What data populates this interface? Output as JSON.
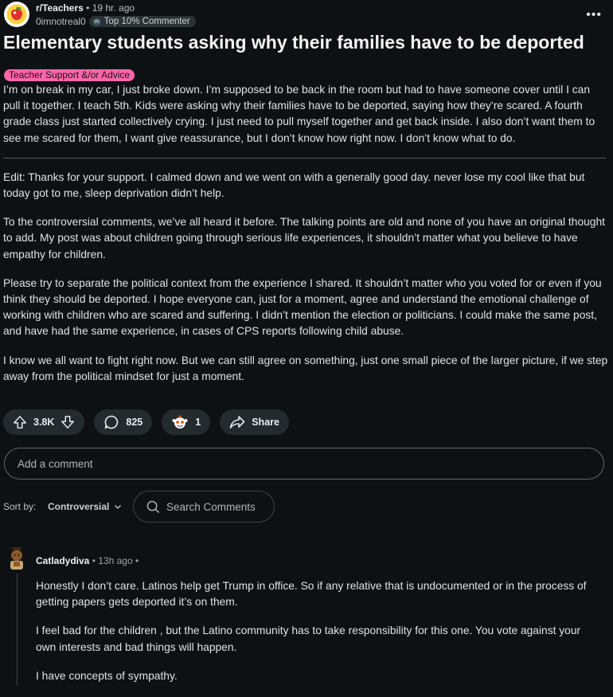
{
  "post": {
    "subreddit": "r/Teachers",
    "time_ago": "19 hr. ago",
    "author": "0imnotreal0",
    "author_badge": "Top 10% Commenter",
    "more_label": "•••",
    "title": "Elementary students asking why their families have to be deported",
    "flair": "Teacher Support &/or Advice",
    "flair_color": "#ff66ac",
    "body_paragraphs": [
      "I’m on break in my car, I just broke down. I’m supposed to be back in the room but had to have someone cover until I can pull it together. I teach 5th. Kids were asking why their families have to be deported, saying how they’re scared. A fourth grade class just started collectively crying. I just need to pull myself together and get back inside. I also don’t want them to see me scared for them, I want give reassurance, but I don’t know how right now. I don’t know what to do.",
      "Edit: Thanks for your support. I calmed down and we went on with a generally good day. never lose my cool like that but today got to me, sleep deprivation didn’t help.",
      "To the controversial comments, we’ve all heard it before. The talking points are old and none of you have an original thought to add. My post was about children going through serious life experiences, it shouldn’t matter what you believe to have empathy for children.",
      "Please try to separate the political context from the experience I shared. It shouldn’t matter who you voted for or even if you think they should be deported. I hope everyone can, just for a moment, agree and understand the emotional challenge of working with children who are scared and suffering. I didn’t mention the election or politicians. I could make the same post, and have had the same experience, in cases of CPS reports following child abuse.",
      "I know we all want to fight right now. But we can still agree on something, just one small piece of the larger picture, if we step away from the political mindset for just a moment."
    ],
    "upvotes": "3.8K",
    "comments_count": "825",
    "awards_count": "1",
    "share_label": "Share"
  },
  "comment_box": {
    "placeholder": "Add a comment"
  },
  "sort": {
    "label": "Sort by:",
    "value": "Controversial"
  },
  "search": {
    "placeholder": "Search Comments"
  },
  "comments": [
    {
      "author": "Catladydiva",
      "time_ago": "13h ago",
      "paragraphs": [
        "Honestly I don’t care. Latinos help get Trump in office. So if any relative that is undocumented or in the process of getting papers gets deported it’s on them.",
        "I feel bad for the children , but the Latino community has to take responsibility for this one. You vote against your own interests and bad things will happen.",
        "I have concepts of sympathy."
      ]
    }
  ],
  "colors": {
    "background": "#0e1113",
    "pill": "#242b2e",
    "text": "#dfe3e6"
  }
}
